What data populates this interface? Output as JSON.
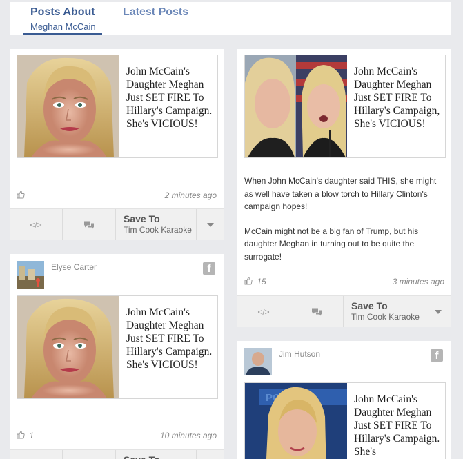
{
  "tabs": [
    {
      "label": "Posts About",
      "sublabel": "Meghan McCain",
      "active": true
    },
    {
      "label": "Latest Posts",
      "active": false
    }
  ],
  "headline": "John McCain's Daughter Meghan Just SET FIRE To Hillary's Campaign. She's VICIOUS!",
  "headline_comma": "John McCain's Daughter Meghan Just SET FIRE To Hillary's Campaign, She's VICIOUS!",
  "headline_partial": "John McCain's Daughter Meghan Just SET FIRE To Hillary's Campaign. She's",
  "cards": {
    "c1": {
      "time": "2 minutes ago",
      "likes": ""
    },
    "c2": {
      "excerpt_1": "When John McCain's daughter said THIS, she might as well have taken a blow torch to Hillary Clinton's campaign hopes!",
      "excerpt_2": "McCain might not be a big fan of Trump, but his daughter Meghan in turning out to be quite the surrogate!",
      "likes": "15",
      "time": "3 minutes ago"
    },
    "c3": {
      "author": "Elyse Carter",
      "likes": "1",
      "time": "10 minutes ago"
    },
    "c4": {
      "author": "Jim Hutson"
    }
  },
  "save": {
    "label": "Save To",
    "target": "Tim Cook Karaoke"
  },
  "icons": {
    "embed": "code-icon",
    "comment": "comment-icon",
    "dropdown": "caret-down-icon",
    "like": "thumbs-up-icon",
    "facebook": "facebook-icon"
  },
  "colors": {
    "accent": "#3a5b92",
    "background": "#e9eaed"
  }
}
